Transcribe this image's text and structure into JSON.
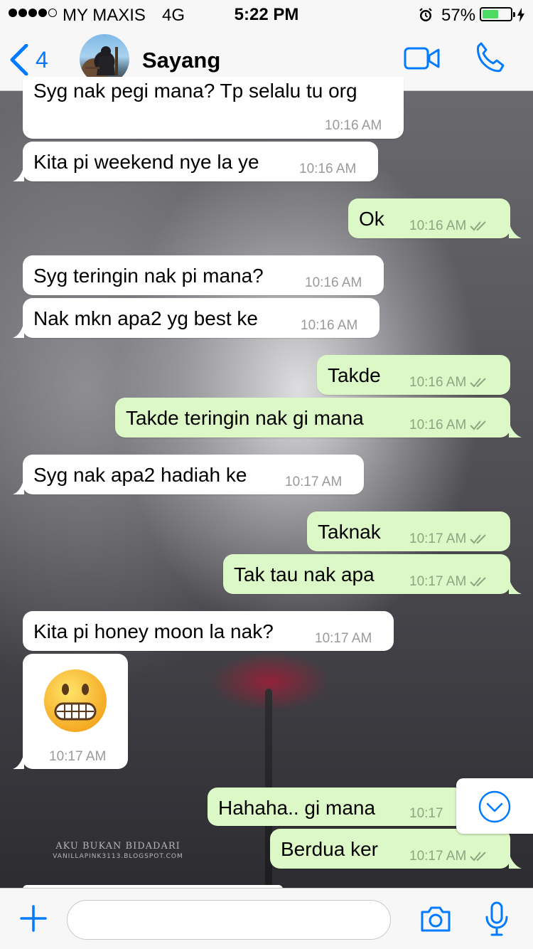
{
  "status_bar": {
    "carrier": "MY MAXIS",
    "network": "4G",
    "time": "5:22 PM",
    "battery": "57%",
    "battery_level": 0.57,
    "icons": [
      "signal-dots-icon",
      "alarm-icon",
      "battery-icon",
      "charging-bolt-icon"
    ]
  },
  "header": {
    "back_count": "4",
    "contact_name": "Sayang",
    "icons": [
      "back-chevron-icon",
      "video-call-icon",
      "phone-call-icon"
    ]
  },
  "messages": [
    {
      "dir": "in",
      "text": "Syg nak pegi mana? Tp selalu tu org",
      "time": "10:16 AM",
      "partially_visible": true
    },
    {
      "dir": "in",
      "text": "Kita pi weekend nye la ye",
      "time": "10:16 AM"
    },
    {
      "dir": "out",
      "text": "Ok",
      "time": "10:16 AM",
      "status": "read"
    },
    {
      "dir": "in",
      "text": "Syg teringin nak pi mana?",
      "time": "10:16 AM"
    },
    {
      "dir": "in",
      "text": "Nak mkn apa2 yg best ke",
      "time": "10:16 AM"
    },
    {
      "dir": "out",
      "text": "Takde",
      "time": "10:16 AM",
      "status": "read"
    },
    {
      "dir": "out",
      "text": "Takde teringin nak gi mana",
      "time": "10:16 AM",
      "status": "read"
    },
    {
      "dir": "in",
      "text": "Syg nak apa2 hadiah ke",
      "time": "10:17 AM"
    },
    {
      "dir": "out",
      "text": "Taknak",
      "time": "10:17 AM",
      "status": "read"
    },
    {
      "dir": "out",
      "text": "Tak tau nak apa",
      "time": "10:17 AM",
      "status": "read"
    },
    {
      "dir": "in",
      "text": "Kita pi honey moon la nak?",
      "time": "10:17 AM"
    },
    {
      "dir": "in",
      "emoji": "grimacing-face",
      "time": "10:17 AM"
    },
    {
      "dir": "out",
      "text": "Hahaha.. gi mana",
      "time": "10:17",
      "partially_hidden": true
    },
    {
      "dir": "out",
      "text": "Berdua ker",
      "time": "10:17 AM",
      "status": "read"
    }
  ],
  "watermark": {
    "line1": "AKU  BUKAN BIDADARI",
    "line2": "VANILLAPINK3113.BLOGSPOT.COM"
  },
  "input_bar": {
    "placeholder": "",
    "value": "",
    "icons": [
      "plus-icon",
      "camera-icon",
      "microphone-icon"
    ]
  },
  "colors": {
    "accent": "#007aff",
    "outgoing_bubble": "#dcf8c6",
    "incoming_bubble": "#ffffff",
    "battery_fill": "#4cd964"
  }
}
